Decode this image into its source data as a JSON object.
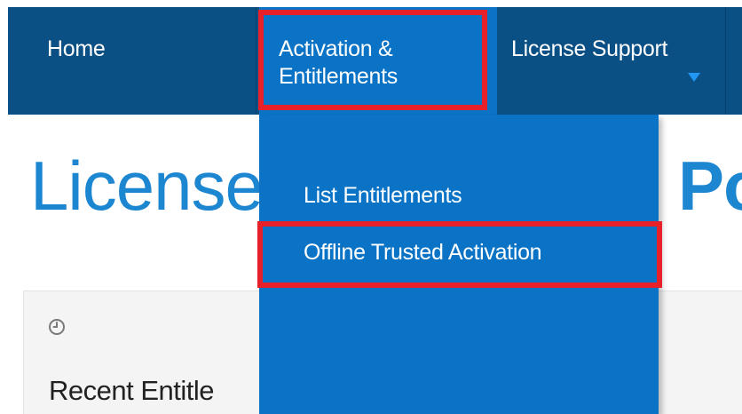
{
  "nav": {
    "home_label": "Home",
    "activation_line1": "Activation &",
    "activation_line2": "Entitlements",
    "license_support_label": "License Support"
  },
  "dropdown": {
    "items": [
      {
        "label": "List Entitlements"
      },
      {
        "label": "Offline Trusted Activation"
      }
    ]
  },
  "page": {
    "title_visible_left": "License",
    "title_visible_right": "Po"
  },
  "panel": {
    "icon": "clock-icon",
    "title": "Recent Entitle"
  },
  "colors": {
    "navbar": "#0b5085",
    "active_nav": "#0a73c5",
    "title": "#1d86d1",
    "highlight": "#e8202a"
  }
}
